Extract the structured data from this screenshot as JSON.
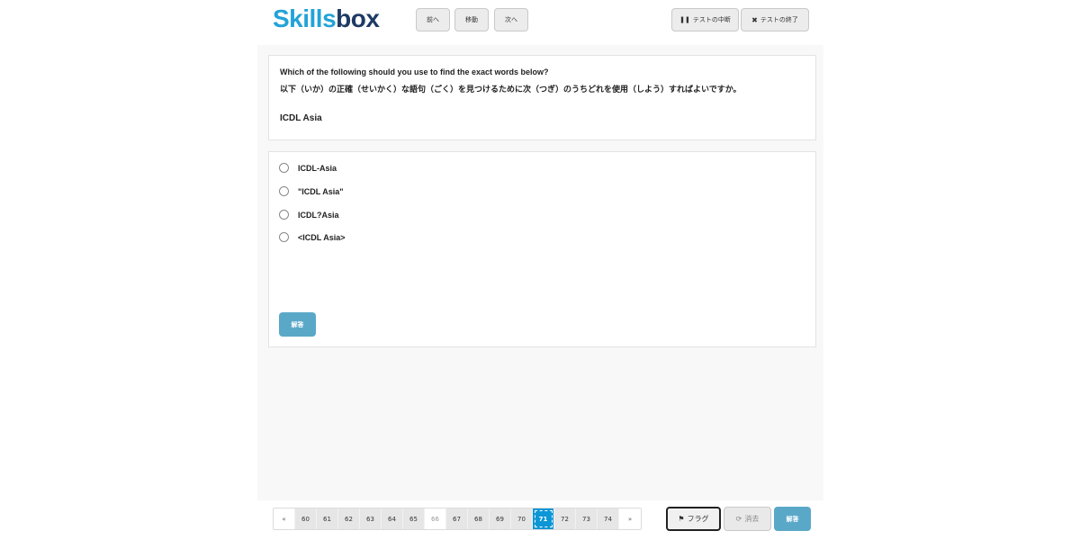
{
  "brand": {
    "part1": "Skills",
    "part2": "box"
  },
  "nav": {
    "prev": "前へ",
    "move": "移動",
    "next": "次へ"
  },
  "test_controls": {
    "pause": "テストの中断",
    "finish": "テストの終了",
    "pause_icon": "pause-icon",
    "finish_icon": "close-icon"
  },
  "question": {
    "english": "Which of the following should you use to find the exact words below?",
    "japanese": "以下（いか）の正確（せいかく）な語句（ごく）を見つけるために次（つぎ）のうちどれを使用（しよう）すればよいですか。",
    "term": "ICDL Asia"
  },
  "options": [
    "ICDL-Asia",
    "\"ICDL Asia\"",
    "ICDL?Asia",
    "<ICDL Asia>"
  ],
  "answer_label": "解答",
  "pagination": {
    "prev": "«",
    "next": "»",
    "pages": [
      "60",
      "61",
      "62",
      "63",
      "64",
      "65",
      "66",
      "67",
      "68",
      "69",
      "70",
      "71",
      "72",
      "73",
      "74"
    ],
    "current": "71"
  },
  "footer": {
    "flag": "フラグ",
    "clear": "消去",
    "answer": "解答",
    "flag_icon": "flag-icon",
    "clear_icon": "refresh-icon"
  },
  "colors": {
    "brand_blue": "#22a3d8",
    "brand_navy": "#1e3a63",
    "answer_button": "#5aa8c8",
    "active_page": "#0d96d6"
  }
}
